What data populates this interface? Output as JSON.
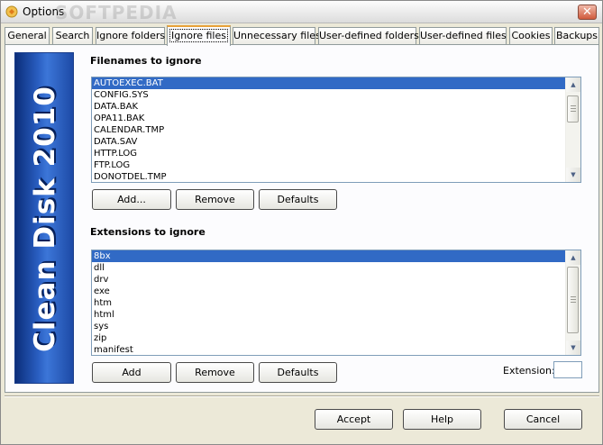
{
  "window": {
    "title": "Options",
    "watermark": "SOFTPEDIA",
    "close_glyph": "✕"
  },
  "tabs": [
    {
      "label": "General"
    },
    {
      "label": "Search"
    },
    {
      "label": "Ignore folders"
    },
    {
      "label": "Ignore files",
      "active": true
    },
    {
      "label": "Unnecessary files"
    },
    {
      "label": "User-defined folders"
    },
    {
      "label": "User-defined files"
    },
    {
      "label": "Cookies"
    },
    {
      "label": "Backups"
    }
  ],
  "banner": {
    "text": "Clean Disk 2010"
  },
  "filenames": {
    "title": "Filenames to ignore",
    "items": [
      "AUTOEXEC.BAT",
      "CONFIG.SYS",
      "DATA.BAK",
      "OPA11.BAK",
      "CALENDAR.TMP",
      "DATA.SAV",
      "HTTP.LOG",
      "FTP.LOG",
      "DONOTDEL.TMP"
    ],
    "selected_index": 0,
    "buttons": {
      "add": "Add...",
      "remove": "Remove",
      "defaults": "Defaults"
    }
  },
  "extensions": {
    "title": "Extensions to ignore",
    "items": [
      "8bx",
      "dll",
      "drv",
      "exe",
      "htm",
      "html",
      "sys",
      "zip",
      "manifest"
    ],
    "selected_index": 0,
    "buttons": {
      "add": "Add",
      "remove": "Remove",
      "defaults": "Defaults"
    },
    "extension_label": "Extension:",
    "extension_value": ""
  },
  "footer": {
    "accept": "Accept",
    "help": "Help",
    "cancel": "Cancel"
  },
  "colors": {
    "selection": "#316ac5",
    "tab_accent": "#e8a23a",
    "banner": "#2a5fc2"
  }
}
